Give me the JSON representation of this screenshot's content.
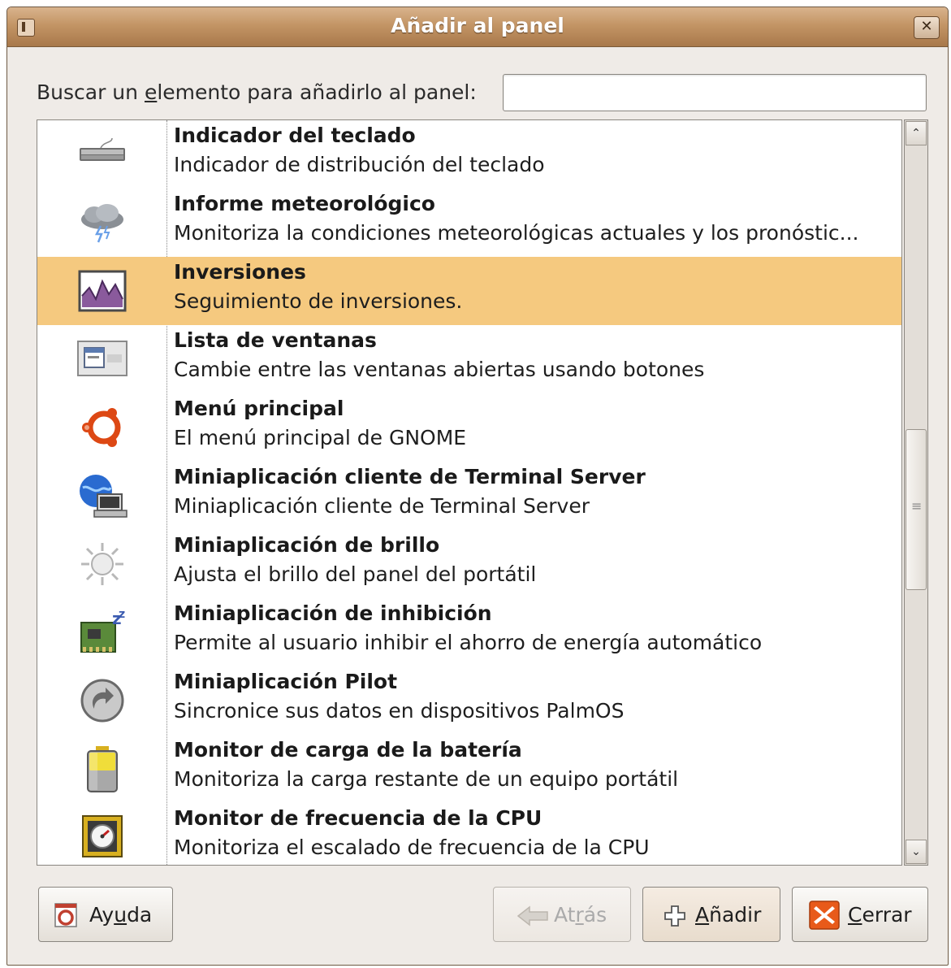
{
  "window": {
    "title": "Añadir al panel",
    "close_glyph": "✕",
    "menu_icon": "window-menu-icon"
  },
  "search": {
    "label_pre": "Buscar un ",
    "label_mn": "e",
    "label_post": "lemento para añadirlo al panel:",
    "value": "",
    "placeholder": ""
  },
  "items": [
    {
      "name": "Indicador del teclado",
      "desc": "Indicador de distribución del teclado",
      "icon": "keyboard-icon"
    },
    {
      "name": "Informe meteorológico",
      "desc": "Monitoriza la condiciones meteorológicas actuales y los pronóstic...",
      "icon": "weather-storm-icon"
    },
    {
      "name": "Inversiones",
      "desc": "Seguimiento de inversiones.",
      "icon": "stock-chart-icon",
      "selected": true
    },
    {
      "name": "Lista de ventanas",
      "desc": "Cambie entre las ventanas abiertas usando botones",
      "icon": "window-list-icon"
    },
    {
      "name": "Menú principal",
      "desc": "El menú principal de GNOME",
      "icon": "ubuntu-logo-icon"
    },
    {
      "name": "Miniaplicación cliente de Terminal Server",
      "desc": "Miniaplicación cliente de Terminal Server",
      "icon": "network-computer-icon"
    },
    {
      "name": "Miniaplicación de brillo",
      "desc": "Ajusta el brillo del panel del portátil",
      "icon": "brightness-sun-icon"
    },
    {
      "name": "Miniaplicación de inhibición",
      "desc": "Permite al usuario inhibir el ahorro de energía automático",
      "icon": "inhibit-chip-icon"
    },
    {
      "name": "Miniaplicación Pilot",
      "desc": "Sincronice sus datos en dispositivos PalmOS",
      "icon": "sync-arrow-icon"
    },
    {
      "name": "Monitor de carga de la batería",
      "desc": "Monitoriza la carga restante de un equipo portátil",
      "icon": "battery-icon"
    },
    {
      "name": "Monitor de frecuencia de la CPU",
      "desc": "Monitoriza el escalado de frecuencia de la CPU",
      "icon": "cpu-gauge-icon"
    }
  ],
  "scrollbar": {
    "up": "⌃",
    "down": "⌄"
  },
  "buttons": {
    "help": {
      "pre": "Ay",
      "mn": "u",
      "post": "da"
    },
    "back": {
      "pre": "At",
      "mn": "r",
      "post": "ás"
    },
    "add": {
      "pre": "",
      "mn": "A",
      "post": "ñadir"
    },
    "close": {
      "pre": "",
      "mn": "C",
      "post": "errar"
    }
  },
  "colors": {
    "selection": "#f5c97f",
    "titlebar": "#c39565"
  }
}
